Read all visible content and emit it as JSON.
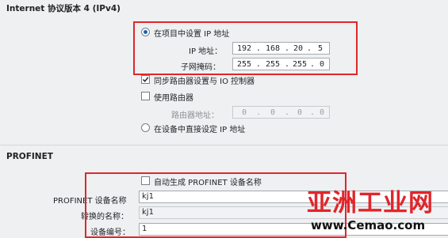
{
  "ipv4": {
    "section_title": "Internet 协议版本 4 (IPv4)",
    "set_in_project_label": "在项目中设置 IP 地址",
    "ip_label": "IP 地址：",
    "ip_octets": [
      "192",
      "168",
      "20",
      "5"
    ],
    "subnet_label": "子网掩码：",
    "subnet_octets": [
      "255",
      "255",
      "255",
      "0"
    ],
    "sync_router_label": "同步路由器设置与 IO 控制器",
    "use_router_label": "使用路由器",
    "router_addr_label": "路由器地址：",
    "router_octets": [
      "0",
      "0",
      "0",
      "0"
    ],
    "set_on_device_label": "在设备中直接设定 IP 地址"
  },
  "profinet": {
    "section_title": "PROFINET",
    "auto_generate_label": "自动生成 PROFINET 设备名称",
    "device_name_label": "PROFINET 设备名称",
    "device_name_value": "kj1",
    "converted_name_label": "转换的名称：",
    "converted_name_value": "kj1",
    "device_number_label": "设备编号：",
    "device_number_value": "1"
  },
  "watermark": {
    "text_cn": "亚洲工业网",
    "text_url": "www.Cemao.com",
    "color": "#e0262b"
  },
  "colors": {
    "highlight_box": "#e0262b",
    "radio_selected": "#1d62b8"
  }
}
